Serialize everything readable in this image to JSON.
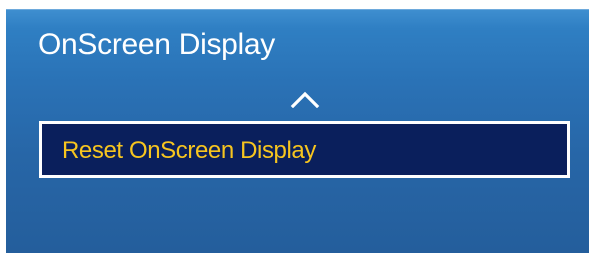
{
  "menu": {
    "title": "OnScreen Display",
    "up_icon": "chevron-up-icon",
    "items": [
      {
        "label": "Reset OnScreen Display",
        "selected": true
      }
    ]
  },
  "colors": {
    "panel_blue": "#2a72b6",
    "selected_bg": "#0a1f5c",
    "selected_text": "#f7c51f",
    "title_text": "#ffffff"
  }
}
